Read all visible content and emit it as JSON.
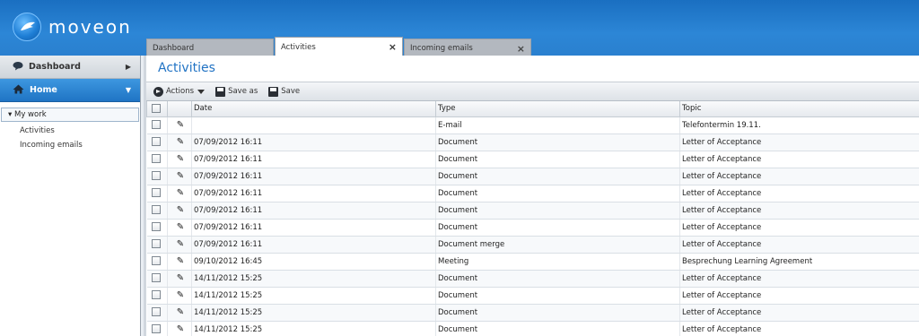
{
  "app": {
    "logo_text": "moveon"
  },
  "tabs": [
    {
      "label": "Dashboard",
      "closable": false
    },
    {
      "label": "Activities",
      "closable": true,
      "active": true
    },
    {
      "label": "Incoming emails",
      "closable": true
    }
  ],
  "sidebar": {
    "dashboard_label": "Dashboard",
    "home_label": "Home",
    "tree_root": "My work",
    "tree_items": [
      "Activities",
      "Incoming emails"
    ]
  },
  "main": {
    "title": "Activities",
    "toolbar": {
      "actions": "Actions",
      "save_as": "Save as",
      "save": "Save"
    },
    "columns": [
      "Date",
      "Type",
      "Topic"
    ],
    "rows": [
      [
        "",
        "E-mail",
        "Telefontermin 19.11."
      ],
      [
        "07/09/2012 16:11",
        "Document",
        "Letter of Acceptance"
      ],
      [
        "07/09/2012 16:11",
        "Document",
        "Letter of Acceptance"
      ],
      [
        "07/09/2012 16:11",
        "Document",
        "Letter of Acceptance"
      ],
      [
        "07/09/2012 16:11",
        "Document",
        "Letter of Acceptance"
      ],
      [
        "07/09/2012 16:11",
        "Document",
        "Letter of Acceptance"
      ],
      [
        "07/09/2012 16:11",
        "Document",
        "Letter of Acceptance"
      ],
      [
        "07/09/2012 16:11",
        "Document merge",
        "Letter of Acceptance"
      ],
      [
        "09/10/2012 16:45",
        "Meeting",
        "Besprechung Learning Agreement"
      ],
      [
        "14/11/2012 15:25",
        "Document",
        "Letter of Acceptance"
      ],
      [
        "14/11/2012 15:25",
        "Document",
        "Letter of Acceptance"
      ],
      [
        "14/11/2012 15:25",
        "Document",
        "Letter of Acceptance"
      ],
      [
        "14/11/2012 15:25",
        "Document",
        "Letter of Acceptance"
      ]
    ]
  },
  "icons": {
    "close": "×",
    "pen": "✎",
    "chevron_right": "▶",
    "chevron_down": "▼",
    "tree_toggle": "▾"
  }
}
